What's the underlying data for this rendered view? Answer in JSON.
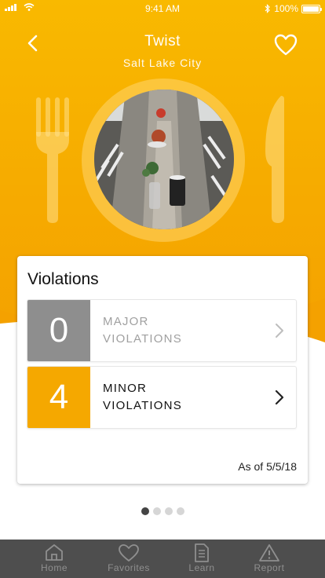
{
  "status_bar": {
    "time": "9:41 AM",
    "battery": "100%"
  },
  "header": {
    "title": "Twist",
    "subtitle": "Salt Lake City"
  },
  "violations_card": {
    "title": "Violations",
    "major": {
      "count": "0",
      "label_line1": "MAJOR",
      "label_line2": "VIOLATIONS"
    },
    "minor": {
      "count": "4",
      "label_line1": "MINOR",
      "label_line2": "VIOLATIONS"
    },
    "as_of": "As of 5/5/18"
  },
  "pager": {
    "pages": 4,
    "current": 1
  },
  "tab_bar": {
    "items": [
      {
        "label": "Home",
        "icon": "home-icon"
      },
      {
        "label": "Favorites",
        "icon": "heart-icon"
      },
      {
        "label": "Learn",
        "icon": "document-icon"
      },
      {
        "label": "Report",
        "icon": "warning-icon"
      }
    ]
  },
  "colors": {
    "accent": "#f5a800",
    "major_badge": "#8e8e8e",
    "tab_bar_bg": "#4e4e4e",
    "tab_inactive": "#8f8f8f"
  }
}
